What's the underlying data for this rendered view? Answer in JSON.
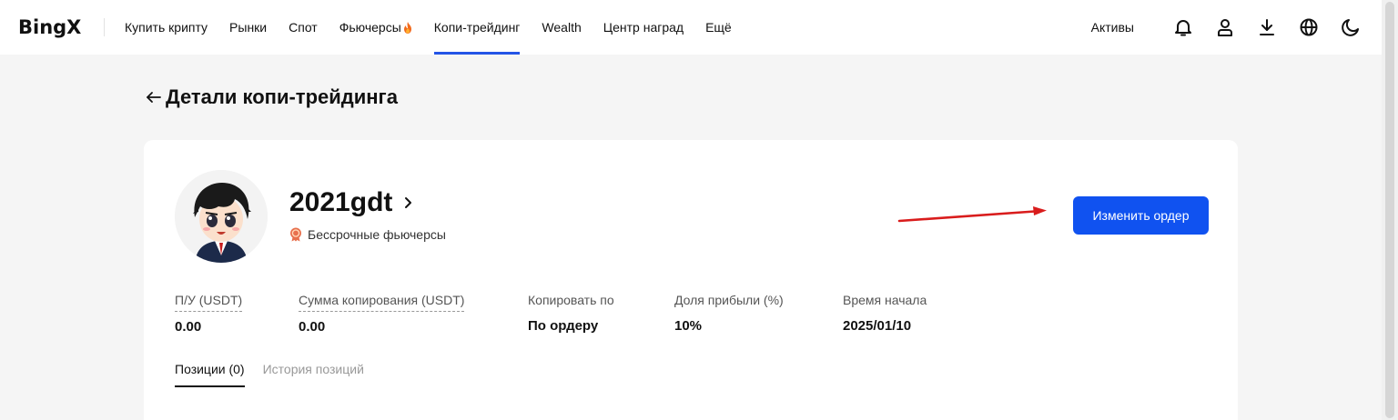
{
  "header": {
    "logo": "BingX",
    "nav": [
      {
        "label": "Купить крипту",
        "name": "nav-buy-crypto"
      },
      {
        "label": "Рынки",
        "name": "nav-markets"
      },
      {
        "label": "Спот",
        "name": "nav-spot"
      },
      {
        "label": "Фьючерсы",
        "name": "nav-futures",
        "fire": true
      },
      {
        "label": "Копи-трейдинг",
        "name": "nav-copy-trading",
        "active": true
      },
      {
        "label": "Wealth",
        "name": "nav-wealth"
      },
      {
        "label": "Центр наград",
        "name": "nav-rewards-center"
      },
      {
        "label": "Ещё",
        "name": "nav-more"
      }
    ],
    "assets_label": "Активы",
    "icons": [
      "bell-icon",
      "user-icon",
      "download-icon",
      "globe-icon",
      "moon-icon"
    ]
  },
  "page": {
    "title": "Детали копи-трейдинга"
  },
  "trader": {
    "name": "2021gdt",
    "type": "Бессрочные фьючерсы",
    "edit_button": "Изменить ордер"
  },
  "stats": [
    {
      "label": "П/У (USDT)",
      "value": "0.00",
      "dotted": true
    },
    {
      "label": "Сумма копирования (USDT)",
      "value": "0.00",
      "dotted": true
    },
    {
      "label": "Копировать по",
      "value": "По ордеру",
      "dotted": false
    },
    {
      "label": "Доля прибыли (%)",
      "value": "10%",
      "dotted": false
    },
    {
      "label": "Время начала",
      "value": "2025/01/10",
      "dotted": false
    }
  ],
  "tabs": [
    {
      "label": "Позиции (0)",
      "active": true
    },
    {
      "label": "История позиций",
      "active": false
    }
  ],
  "colors": {
    "accent": "#1052f0",
    "nav_underline": "#2354e6",
    "annotation_arrow": "#d91c1c"
  }
}
